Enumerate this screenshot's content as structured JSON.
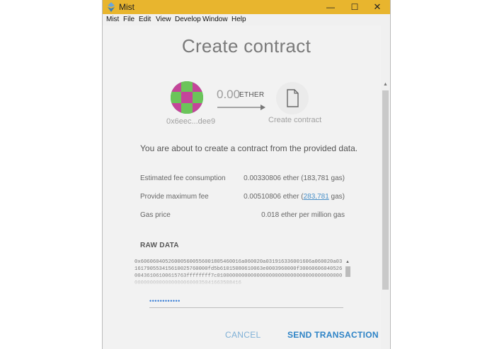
{
  "window": {
    "title": "Mist"
  },
  "window_controls": {
    "minimize": "—",
    "maximize": "☐",
    "close": "✕"
  },
  "menu": [
    "Mist",
    "File",
    "Edit",
    "View",
    "Develop",
    "Window",
    "Help"
  ],
  "page": {
    "title": "Create contract"
  },
  "transfer": {
    "from_address": "0x6eec...dee9",
    "amount": "0.00",
    "unit": "ETHER",
    "to_label": "Create contract"
  },
  "intro_text": "You are about to create a contract from the provided data.",
  "fees": {
    "estimated_label": "Estimated fee consumption",
    "estimated_value": "0.00330806 ether (183,781 gas)",
    "max_label": "Provide maximum fee",
    "max_prefix": "0.00510806 ether (",
    "max_gas_link": "283,781",
    "max_suffix": " gas)",
    "gas_price_label": "Gas price",
    "gas_price_value": "0.018 ether per million gas"
  },
  "raw_data": {
    "title": "RAW DATA",
    "value": "0x606060405260005600556001805460016a060020a031916336001606a060020a03161790553415610025760000fd5b61015080610063e0003960000f3006060604052600436106100615763ffffffff7c0100000000000000000000000000000000000000000000000000000000600035041663508416"
  },
  "password": {
    "value": "••••••••••••"
  },
  "buttons": {
    "cancel": "CANCEL",
    "send": "SEND TRANSACTION"
  },
  "colors": {
    "titlebar": "#e8b52e",
    "link": "#4a90c8",
    "primary": "#2d83c6"
  }
}
